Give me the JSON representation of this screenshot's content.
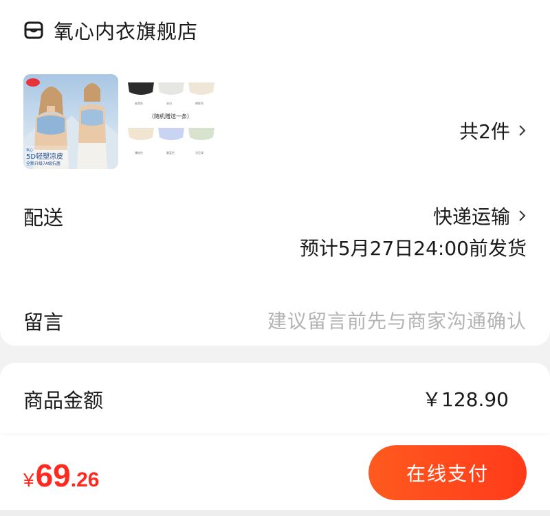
{
  "store": {
    "name": "氧心内衣旗舰店",
    "icon": "store-icon"
  },
  "products": {
    "thumb1": {
      "title": "5D轻塑凉皮",
      "subtitle": "全新升级7A级抗菌",
      "brand": "氧心"
    },
    "thumb2": {
      "caption": "（随机赠送一条）",
      "labels": [
        "碳黑色",
        "米白",
        "裸肤色",
        "裸粉色",
        "雾蓝色",
        "浅豆绿"
      ]
    },
    "count_label": "共2件"
  },
  "delivery": {
    "label": "配送",
    "method": "快递运输",
    "eta": "预计5月27日24:00前发货"
  },
  "note": {
    "label": "留言",
    "placeholder": "建议留言前先与商家沟通确认"
  },
  "amount": {
    "label": "商品金额",
    "value": "￥128.90"
  },
  "footer": {
    "currency": "¥",
    "total_int": "69",
    "total_dec": ".26",
    "pay_label": "在线支付"
  },
  "colors": {
    "accent": "#ff3a1a",
    "price": "#ff2a1f",
    "placeholder": "#b3b3b3"
  }
}
